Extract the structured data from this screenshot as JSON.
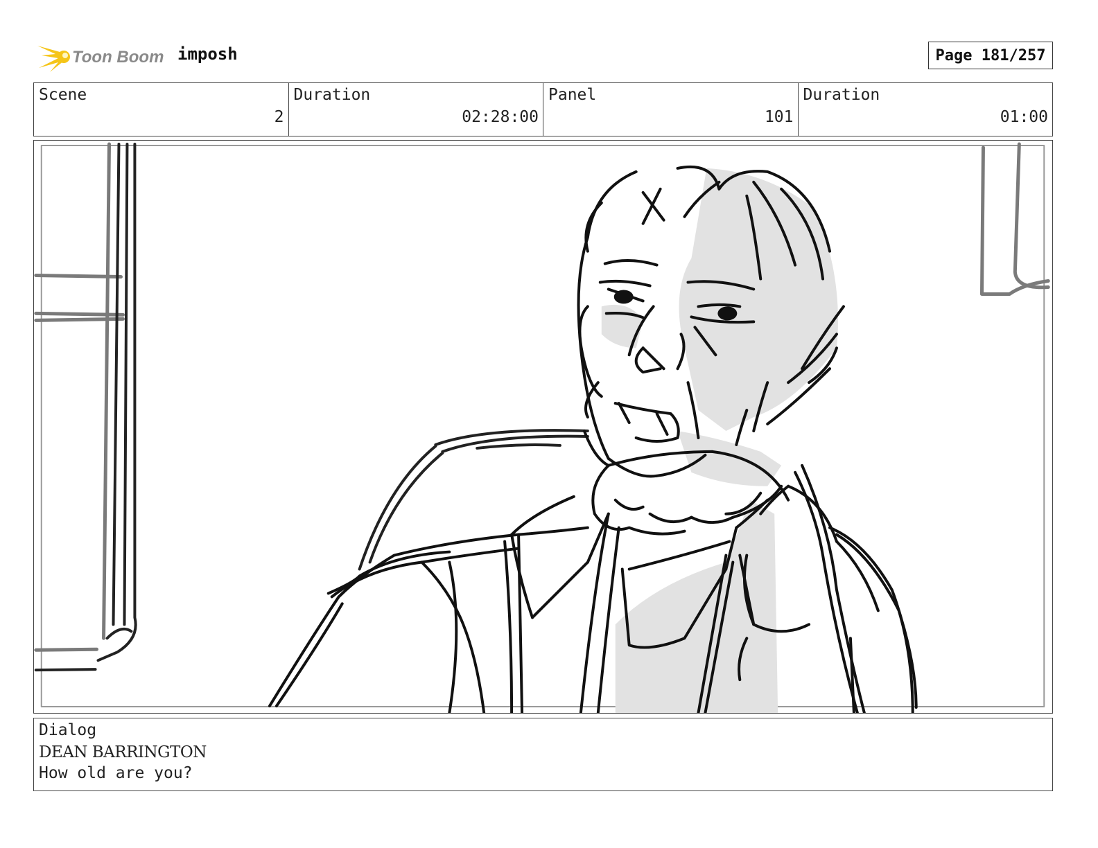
{
  "header": {
    "logo_text": "Toon Boom",
    "project_name": "imposh",
    "page_indicator": "Page 181/257"
  },
  "info": {
    "scene_label": "Scene",
    "scene_value": "2",
    "scene_duration_label": "Duration",
    "scene_duration_value": "02:28:00",
    "panel_label": "Panel",
    "panel_value": "101",
    "panel_duration_label": "Duration",
    "panel_duration_value": "01:00"
  },
  "dialog": {
    "label": "Dialog",
    "speaker": "DEAN BARRINGTON",
    "line": "How old are you?"
  },
  "colors": {
    "logo_star": "#f5c518",
    "logo_text": "#8a8a8a",
    "border": "#444444",
    "sketch_line": "#111111",
    "sketch_gray": "#7a7a7a",
    "sketch_fill": "#e2e2e2"
  }
}
